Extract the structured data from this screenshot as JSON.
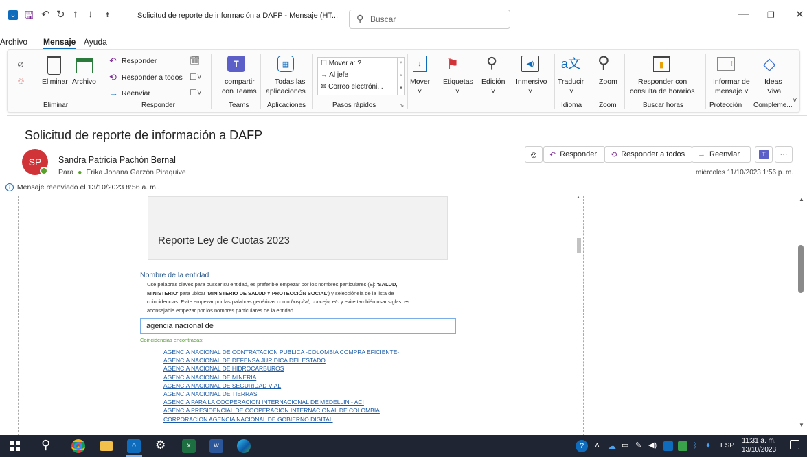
{
  "window": {
    "title": "Solicitud de reporte de información a DAFP  -  Mensaje (HT...",
    "search_placeholder": "Buscar"
  },
  "menu": [
    "Archivo",
    "Mensaje",
    "Ayuda"
  ],
  "ribbon": {
    "groups": {
      "eliminar": "Eliminar",
      "responder": "Responder",
      "teams": "Teams",
      "aplicaciones": "Aplicaciones",
      "pasos": "Pasos rápidos",
      "idioma": "Idioma",
      "zoom": "Zoom",
      "buscar_horas": "Buscar horas",
      "proteccion": "Protección",
      "complementos": "Compleme..."
    },
    "eliminar_btn": "Eliminar",
    "archivo_btn": "Archivo",
    "responder_btn": "Responder",
    "responder_todos_btn": "Responder a todos",
    "reenviar_btn": "Reenviar",
    "teams_btn_1": "compartir",
    "teams_btn_2": "con Teams",
    "apps_btn_1": "Todas las",
    "apps_btn_2": "aplicaciones",
    "quick_steps": [
      "Mover a: ?",
      "Al jefe",
      "Correo electróni..."
    ],
    "mover_btn": "Mover",
    "etiquetas_btn": "Etiquetas",
    "edicion_btn": "Edición",
    "inmersivo_btn": "Inmersivo",
    "traducir_btn": "Traducir",
    "zoom_btn": "Zoom",
    "horarios_btn_1": "Responder con",
    "horarios_btn_2": "consulta de horarios",
    "informar_btn_1": "Informar de",
    "informar_btn_2": "mensaje ˅",
    "ideas_btn_1": "Ideas",
    "ideas_btn_2": "Viva"
  },
  "message": {
    "subject": "Solicitud de reporte de información a DAFP",
    "sender": "Sandra Patricia Pachón Bernal",
    "avatar_initials": "SP",
    "to_label": "Para",
    "to_name": "Erika Johana Garzón Piraquive",
    "forward_info": "Mensaje reenviado el 13/10/2023 8:56 a. m..",
    "date": "miércoles 11/10/2023 1:56 p. m.",
    "actions": {
      "reply": "Responder",
      "reply_all": "Responder a todos",
      "forward": "Reenviar"
    }
  },
  "body": {
    "report_title": "Reporte Ley de Cuotas 2023",
    "field_label": "Nombre de la entidad",
    "help_line1": "Use palabras claves para buscar su entidad, es preferible empezar por los nombres particulares (Ej: ",
    "help_b1": "'SALUD,",
    "help_b2": "MINISTERIO'",
    "help_line2a": " para ubicar '",
    "help_b3": "MINISTERIO DE SALUD Y PROTECCIÓN SOCIAL",
    "help_line2b": "') y selecciónela de la lista de",
    "help_line3a": "coincidencias. Evite empezar por las palabras genéricas como ",
    "help_i": "hospital, concejo, etc",
    "help_line3b": " y evite también usar siglas, es",
    "help_line4": "aconsejable empezar por los nombres particulares de la entidad.",
    "input_value": "agencia nacional de",
    "matches_label": "Coincidencias encontradas:",
    "matches": [
      "AGENCIA NACIONAL DE CONTRATACION PUBLICA -COLOMBIA COMPRA EFICIENTE-",
      "AGENCIA NACIONAL DE DEFENSA JURIDICA DEL ESTADO",
      "AGENCIA NACIONAL DE HIDROCARBUROS",
      "AGENCIA NACIONAL DE MINERIA",
      "AGENCIA NACIONAL DE SEGURIDAD VIAL",
      "AGENCIA NACIONAL DE TIERRAS",
      "AGENCIA PARA LA COOPERACION INTERNACIONAL DE MEDELLIN - ACI",
      "AGENCIA PRESIDENCIAL DE COOPERACION INTERNACIONAL DE COLOMBIA",
      "CORPORACION AGENCIA NACIONAL DE GOBIERNO DIGITAL"
    ]
  },
  "taskbar": {
    "lang": "ESP",
    "time": "11:31 a. m.",
    "date": "13/10/2023"
  },
  "colors": {
    "accent": "#0f6cbd",
    "avatar": "#d13438",
    "taskbar": "#202534",
    "link": "#1a5aa6"
  }
}
